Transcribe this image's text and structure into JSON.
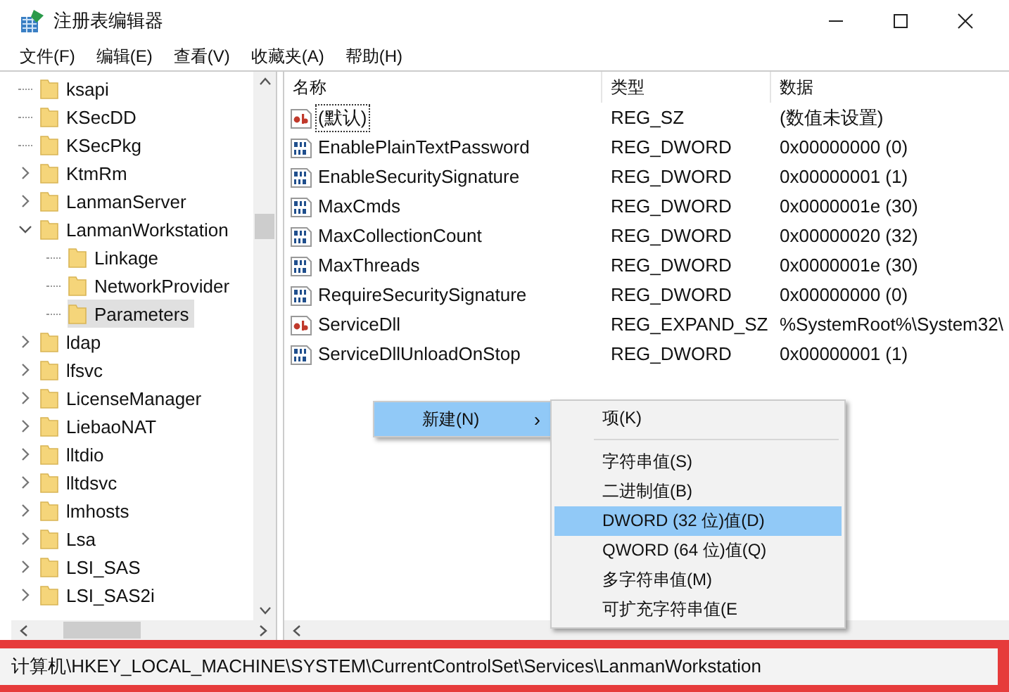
{
  "window": {
    "title": "注册表编辑器"
  },
  "menu": [
    "文件(F)",
    "编辑(E)",
    "查看(V)",
    "收藏夹(A)",
    "帮助(H)"
  ],
  "tree": [
    {
      "label": "ksapi",
      "selected": false
    },
    {
      "label": "KSecDD",
      "selected": false
    },
    {
      "label": "KSecPkg",
      "selected": false
    },
    {
      "label": "KtmRm",
      "expanded": false,
      "selected": false
    },
    {
      "label": "LanmanServer",
      "expanded": false,
      "selected": false
    },
    {
      "label": "LanmanWorkstation",
      "expanded": true,
      "selected": false,
      "children": [
        {
          "label": "Linkage",
          "selected": false
        },
        {
          "label": "NetworkProvider",
          "selected": false
        },
        {
          "label": "Parameters",
          "selected": true
        }
      ]
    },
    {
      "label": "ldap",
      "expanded": false,
      "selected": false
    },
    {
      "label": "lfsvc",
      "expanded": false,
      "selected": false
    },
    {
      "label": "LicenseManager",
      "expanded": false,
      "selected": false
    },
    {
      "label": "LiebaoNAT",
      "expanded": false,
      "selected": false
    },
    {
      "label": "lltdio",
      "expanded": false,
      "selected": false
    },
    {
      "label": "lltdsvc",
      "expanded": false,
      "selected": false
    },
    {
      "label": "lmhosts",
      "expanded": false,
      "selected": false
    },
    {
      "label": "Lsa",
      "expanded": false,
      "selected": false
    },
    {
      "label": "LSI_SAS",
      "expanded": false,
      "selected": false
    },
    {
      "label": "LSI_SAS2i",
      "expanded": false,
      "selected": false
    }
  ],
  "table": {
    "columns": [
      "名称",
      "类型",
      "数据"
    ],
    "rows": [
      {
        "kind": "string",
        "name": "(默认)",
        "type": "REG_SZ",
        "data": "(数值未设置)",
        "focused": true
      },
      {
        "kind": "binary",
        "name": "EnablePlainTextPassword",
        "type": "REG_DWORD",
        "data": "0x00000000 (0)",
        "focused": false
      },
      {
        "kind": "binary",
        "name": "EnableSecuritySignature",
        "type": "REG_DWORD",
        "data": "0x00000001 (1)",
        "focused": false
      },
      {
        "kind": "binary",
        "name": "MaxCmds",
        "type": "REG_DWORD",
        "data": "0x0000001e (30)",
        "focused": false
      },
      {
        "kind": "binary",
        "name": "MaxCollectionCount",
        "type": "REG_DWORD",
        "data": "0x00000020 (32)",
        "focused": false
      },
      {
        "kind": "binary",
        "name": "MaxThreads",
        "type": "REG_DWORD",
        "data": "0x0000001e (30)",
        "focused": false
      },
      {
        "kind": "binary",
        "name": "RequireSecuritySignature",
        "type": "REG_DWORD",
        "data": "0x00000000 (0)",
        "focused": false
      },
      {
        "kind": "string",
        "name": "ServiceDll",
        "type": "REG_EXPAND_SZ",
        "data": "%SystemRoot%\\System32\\",
        "focused": false
      },
      {
        "kind": "binary",
        "name": "ServiceDllUnloadOnStop",
        "type": "REG_DWORD",
        "data": "0x00000001 (1)",
        "focused": false
      }
    ]
  },
  "context_menu": {
    "items": [
      {
        "label": "新建(N)",
        "arrow": "›",
        "selected": true
      }
    ]
  },
  "submenu": {
    "items": [
      {
        "kind": "item",
        "label": "项(K)",
        "selected": false
      },
      {
        "kind": "separator"
      },
      {
        "kind": "item",
        "label": "字符串值(S)",
        "selected": false
      },
      {
        "kind": "item",
        "label": "二进制值(B)",
        "selected": false
      },
      {
        "kind": "item",
        "label": "DWORD (32 位)值(D)",
        "selected": true
      },
      {
        "kind": "item",
        "label": "QWORD (64 位)值(Q)",
        "selected": false
      },
      {
        "kind": "item",
        "label": "多字符串值(M)",
        "selected": false
      },
      {
        "kind": "item",
        "label": "可扩充字符串值(E",
        "selected": false
      }
    ]
  },
  "status_bar": {
    "path": "计算机\\HKEY_LOCAL_MACHINE\\SYSTEM\\CurrentControlSet\\Services\\LanmanWorkstation",
    "highlighted": true
  }
}
